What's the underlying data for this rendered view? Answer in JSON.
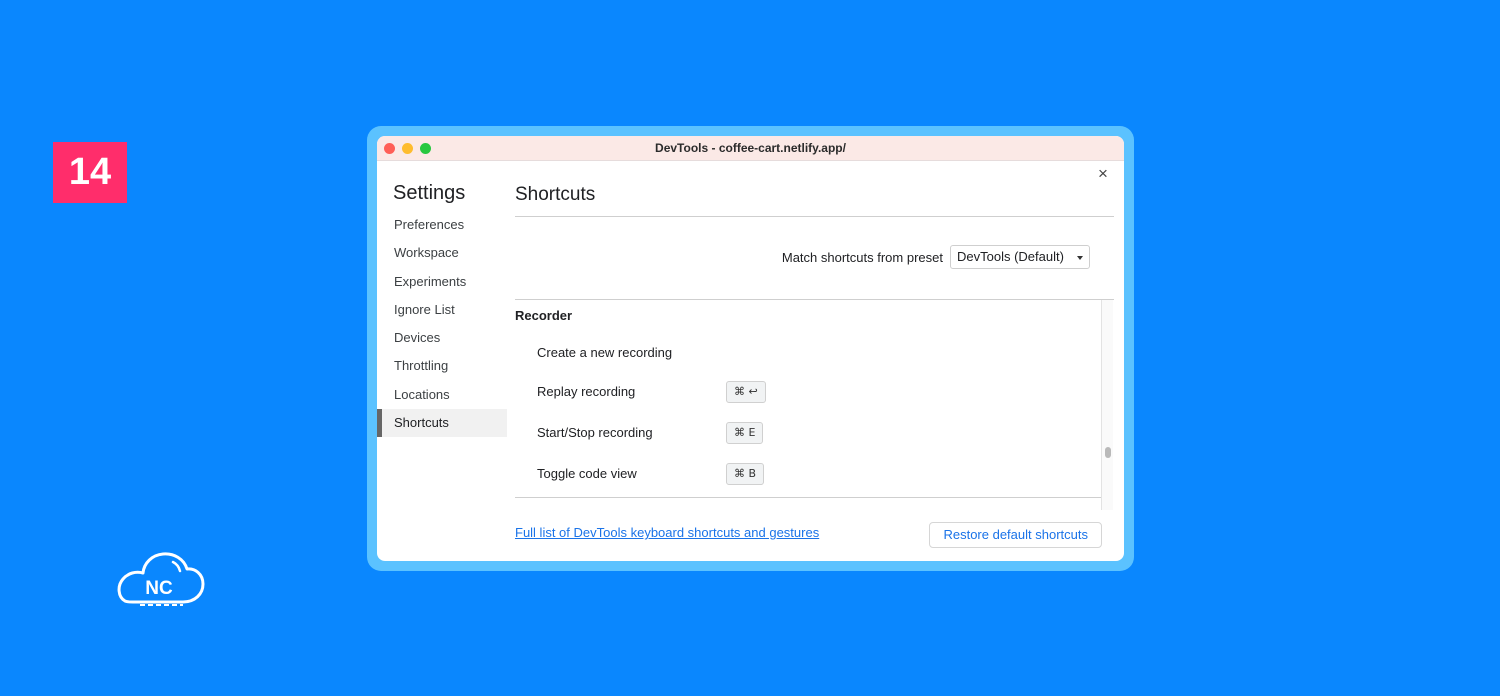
{
  "badge": {
    "number": "14"
  },
  "brand": {
    "logo_text": "NC"
  },
  "window": {
    "title": "DevTools - coffee-cart.netlify.app/",
    "close_glyph": "×"
  },
  "sidebar": {
    "title": "Settings",
    "items": [
      {
        "label": "Preferences"
      },
      {
        "label": "Workspace"
      },
      {
        "label": "Experiments"
      },
      {
        "label": "Ignore List"
      },
      {
        "label": "Devices"
      },
      {
        "label": "Throttling"
      },
      {
        "label": "Locations"
      },
      {
        "label": "Shortcuts",
        "active": true
      }
    ]
  },
  "content": {
    "title": "Shortcuts",
    "preset": {
      "label": "Match shortcuts from preset",
      "selected": "DevTools (Default)"
    },
    "section": {
      "title": "Recorder",
      "shortcuts": [
        {
          "label": "Create a new recording",
          "keys": ""
        },
        {
          "label": "Replay recording",
          "keys": "⌘ ↩"
        },
        {
          "label": "Start/Stop recording",
          "keys": "⌘ E"
        },
        {
          "label": "Toggle code view",
          "keys": "⌘ B"
        }
      ]
    },
    "footer": {
      "link": "Full list of DevTools keyboard shortcuts and gestures",
      "restore_button": "Restore default shortcuts"
    }
  },
  "colors": {
    "background": "#0a87fe",
    "badge": "#ff2d6b",
    "frame": "#5bc2ff",
    "accent_link": "#1a73e8"
  }
}
